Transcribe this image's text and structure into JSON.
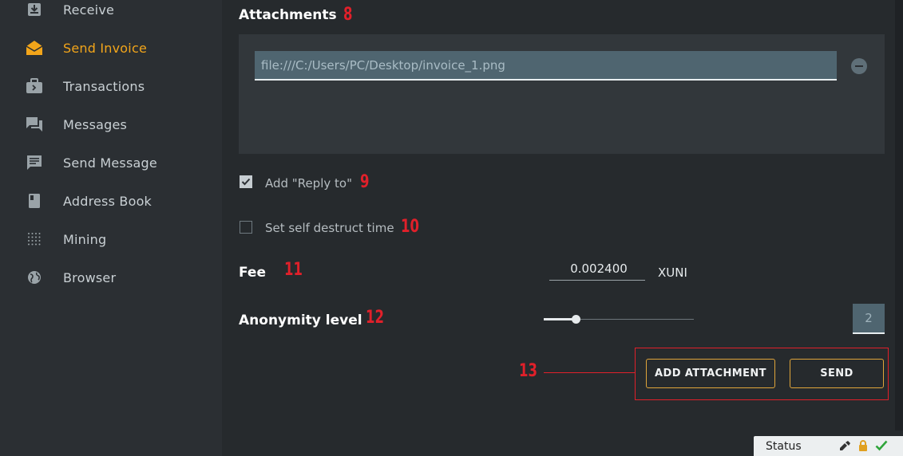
{
  "sidebar": {
    "items": [
      {
        "label": "Receive",
        "icon": "receive-icon"
      },
      {
        "label": "Send Invoice",
        "icon": "envelope-open-icon",
        "active": true
      },
      {
        "label": "Transactions",
        "icon": "briefcase-icon"
      },
      {
        "label": "Messages",
        "icon": "chat-bubbles-icon"
      },
      {
        "label": "Send Message",
        "icon": "message-icon"
      },
      {
        "label": "Address Book",
        "icon": "book-icon"
      },
      {
        "label": "Mining",
        "icon": "grid-dots-icon"
      },
      {
        "label": "Browser",
        "icon": "globe-icon"
      }
    ],
    "accent_color": "#f2a51a"
  },
  "attachments": {
    "title": "Attachments",
    "file_value": "file:///C:/Users/PC/Desktop/invoice_1.png"
  },
  "options": {
    "reply_to": {
      "label": "Add \"Reply to\"",
      "checked": true
    },
    "self_destruct": {
      "label": "Set self destruct time",
      "checked": false
    }
  },
  "fee": {
    "label": "Fee",
    "value": "0.002400",
    "unit": "XUNI"
  },
  "anonymity": {
    "label": "Anonymity level",
    "value": "2"
  },
  "buttons": {
    "add_attachment": "ADD ATTACHMENT",
    "send": "SEND"
  },
  "markers": {
    "m8": "8",
    "m9": "9",
    "m10": "10",
    "m11": "11",
    "m12": "12",
    "m13": "13"
  },
  "status": {
    "label": "Status",
    "icons": [
      "network-icon",
      "lock-icon",
      "check-icon"
    ]
  }
}
